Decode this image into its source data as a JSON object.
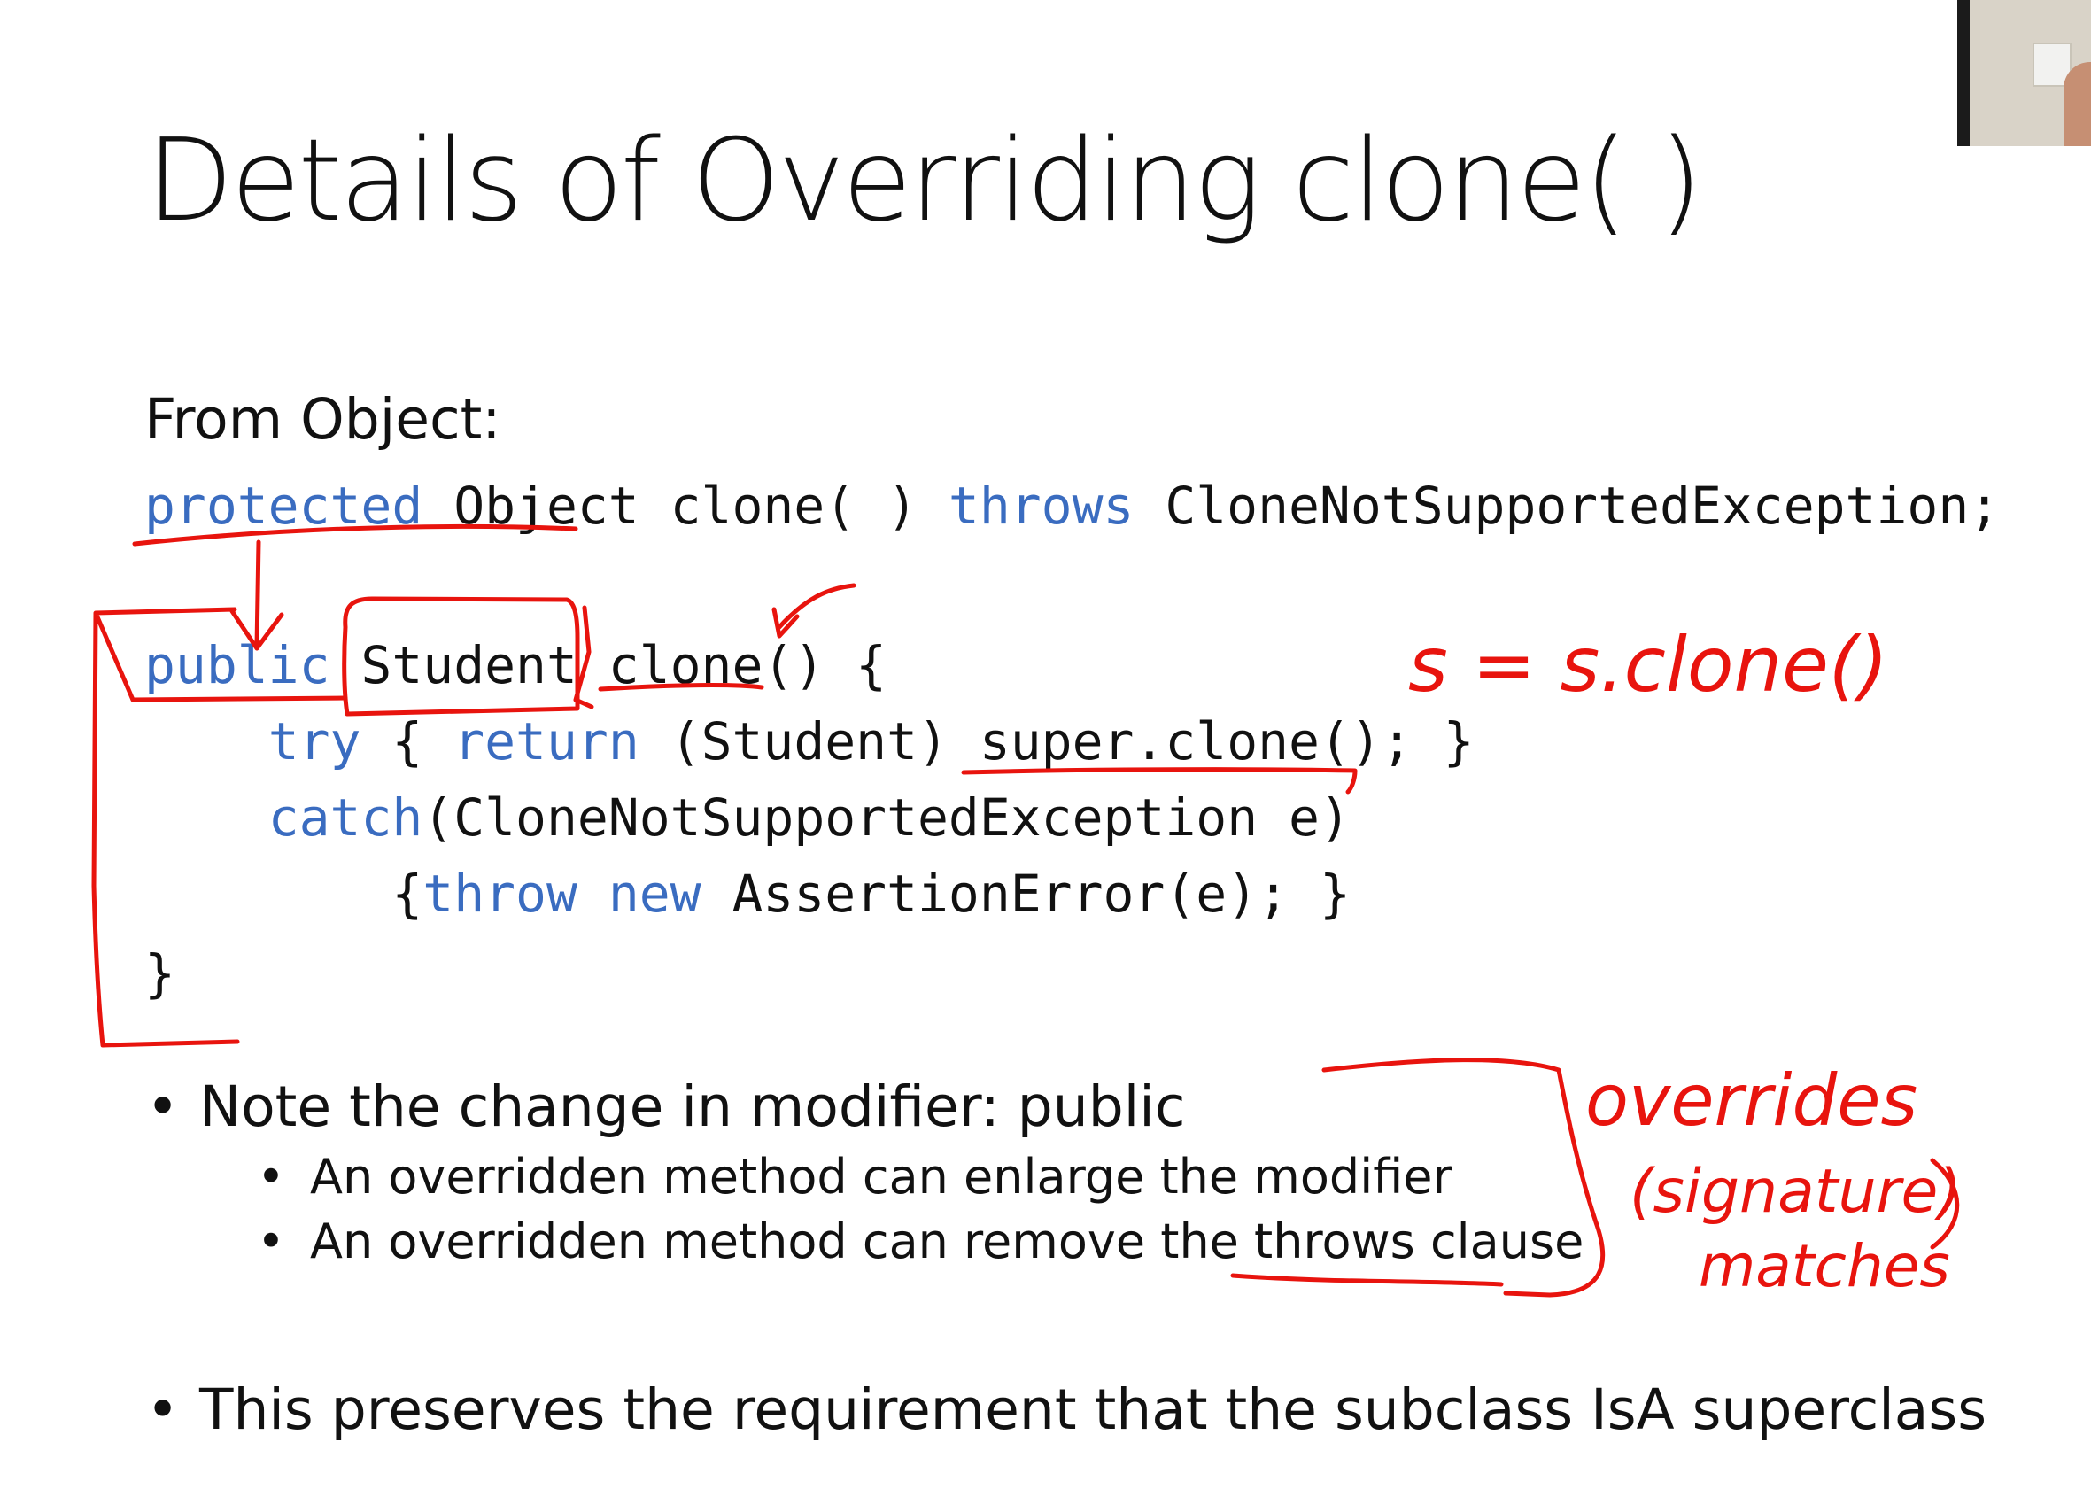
{
  "slide": {
    "title": "Details of Overriding clone( )",
    "from_label": "From Object:",
    "code": {
      "line1": {
        "protected": "protected",
        "object": " Object clone( ) ",
        "throws": "throws",
        "rest": " CloneNotSupportedException;"
      },
      "line2": {
        "public": "public",
        "rest": " Student clone() {"
      },
      "line3": {
        "indent": "    ",
        "try": "try",
        "mid": " { ",
        "return": "return",
        "rest": " (Student) super.clone(); }"
      },
      "line4": {
        "indent": "    ",
        "catch": "catch",
        "rest": "(CloneNotSupportedException e)"
      },
      "line5": {
        "indent": "        {",
        "throw": "throw",
        "space": " ",
        "new": "new",
        "rest": " AssertionError(e); }"
      },
      "line6": "}"
    },
    "bullets": [
      {
        "text": "Note the change in modifier: public",
        "sub": [
          "An overridden method can enlarge the modifier",
          "An overridden method can remove the throws clause"
        ]
      },
      {
        "text": "This preserves the requirement that the subclass IsA superclass"
      }
    ],
    "bullet_glyph": "•",
    "annotations": {
      "assignment": "s = s.clone()",
      "overrides": "overrides",
      "signature": "(signature)",
      "matches": "matches"
    }
  },
  "colors": {
    "keyword": "#3a6cc0",
    "ink": "#e8140e",
    "text": "#111111",
    "background": "#ffffff"
  }
}
